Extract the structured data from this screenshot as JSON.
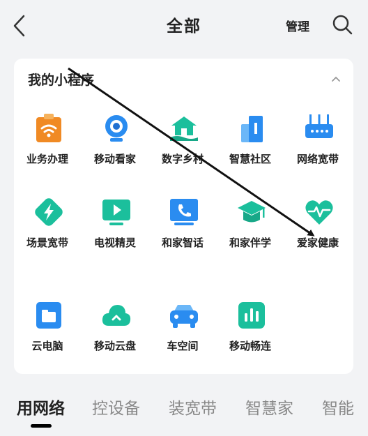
{
  "header": {
    "title": "全部",
    "manage_label": "管理"
  },
  "card": {
    "title": "我的小程序",
    "apps": [
      {
        "label": "业务办理",
        "icon": "business-icon"
      },
      {
        "label": "移动看家",
        "icon": "camera-icon"
      },
      {
        "label": "数字乡村",
        "icon": "village-icon"
      },
      {
        "label": "智慧社区",
        "icon": "community-icon"
      },
      {
        "label": "网络宽带",
        "icon": "router-icon"
      },
      {
        "label": "场景宽带",
        "icon": "lightning-icon"
      },
      {
        "label": "电视精灵",
        "icon": "tv-play-icon"
      },
      {
        "label": "和家智话",
        "icon": "phone-tv-icon"
      },
      {
        "label": "和家伴学",
        "icon": "graduation-cap-icon"
      },
      {
        "label": "爱家健康",
        "icon": "heart-pulse-icon"
      },
      {
        "label": "云电脑",
        "icon": "cloud-pc-icon"
      },
      {
        "label": "移动云盘",
        "icon": "cloud-drive-icon"
      },
      {
        "label": "车空间",
        "icon": "car-icon"
      },
      {
        "label": "移动畅连",
        "icon": "chat-icon"
      }
    ]
  },
  "tabs": [
    "用网络",
    "控设备",
    "装宽带",
    "智慧家",
    "智能"
  ],
  "colors": {
    "orange": "#f08a24",
    "blue": "#2a8cf0",
    "teal": "#1bbf9c",
    "arrow": "#111111"
  }
}
